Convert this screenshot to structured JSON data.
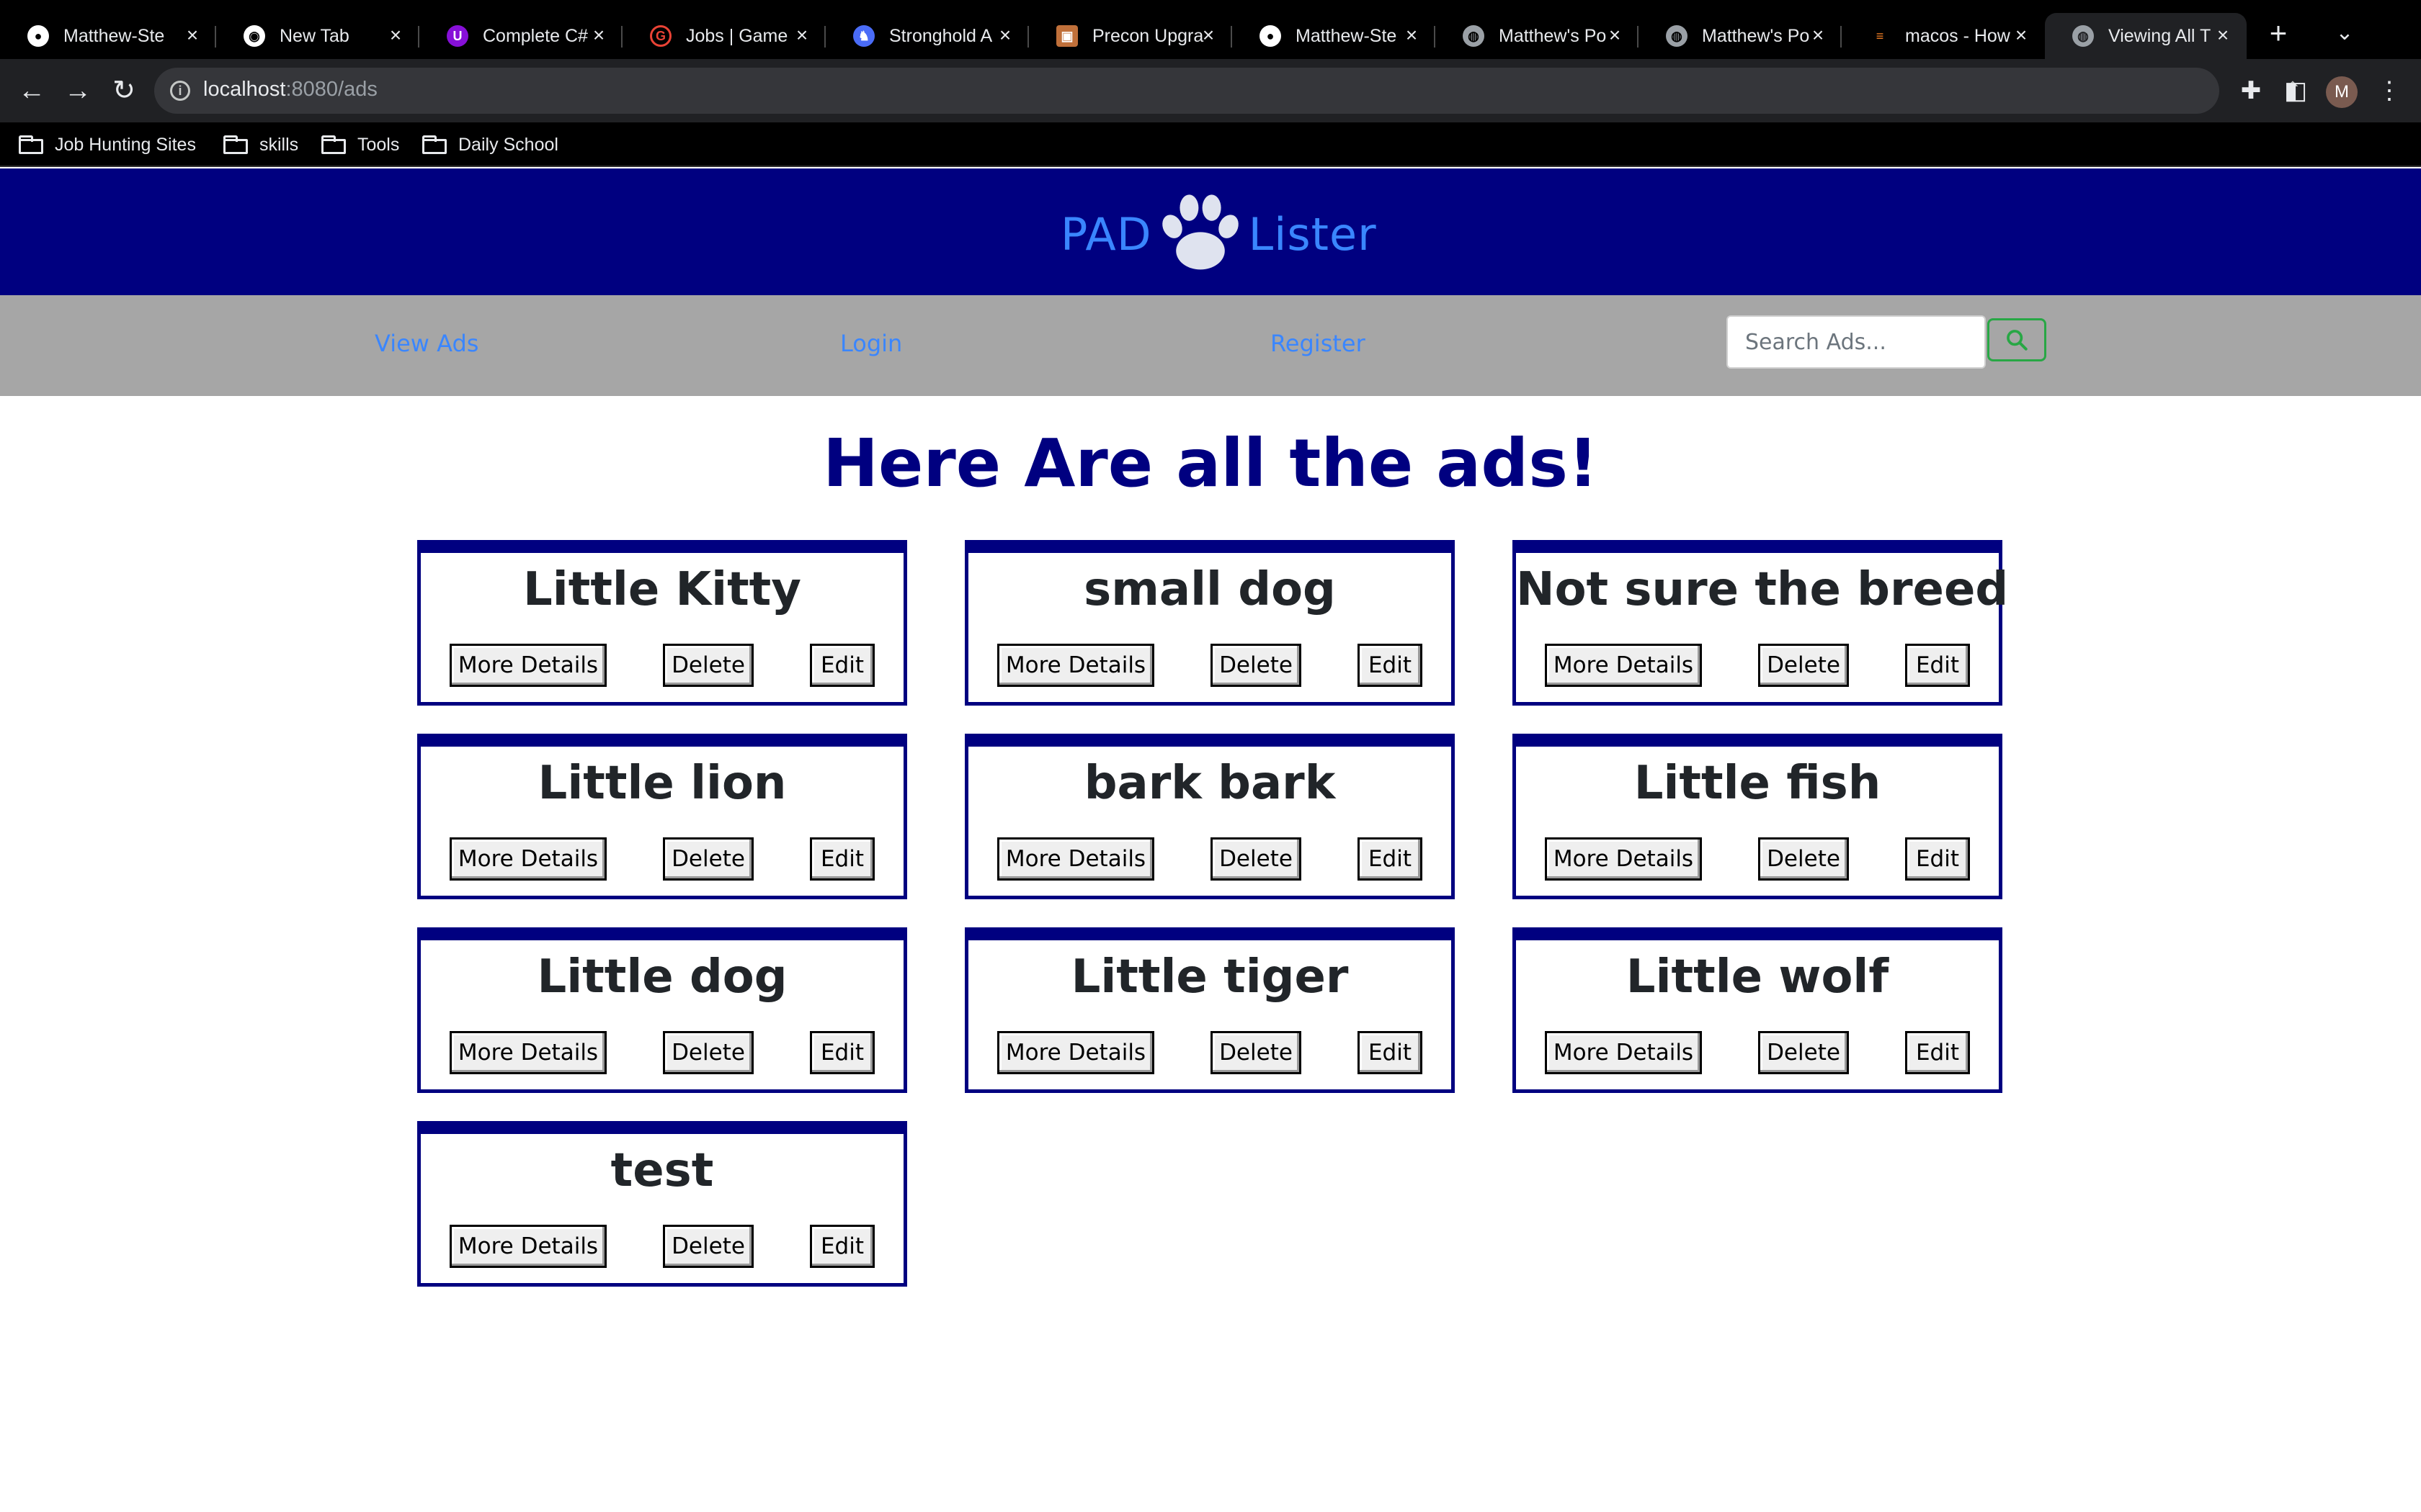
{
  "browser": {
    "tabs": [
      {
        "title": "Matthew-Ste",
        "icon": "github-icon",
        "color": "#ffffff"
      },
      {
        "title": "New Tab",
        "icon": "chrome-icon",
        "color": "#ffffff"
      },
      {
        "title": "Complete C#",
        "icon": "udemy-icon",
        "color": "#8710d8"
      },
      {
        "title": "Jobs | Game",
        "icon": "google-icon",
        "color": "#ea4335"
      },
      {
        "title": "Stronghold A",
        "icon": "game-icon",
        "color": "#4a6cf7"
      },
      {
        "title": "Precon Upgra",
        "icon": "card-icon",
        "color": "#c0703a"
      },
      {
        "title": "Matthew-Ste",
        "icon": "github-icon",
        "color": "#ffffff"
      },
      {
        "title": "Matthew's Po",
        "icon": "globe-icon",
        "color": "#9aa0a6"
      },
      {
        "title": "Matthew's Po",
        "icon": "globe-icon",
        "color": "#9aa0a6"
      },
      {
        "title": "macos - How",
        "icon": "stackoverflow-icon",
        "color": "#f48024"
      },
      {
        "title": "Viewing All T",
        "icon": "globe-icon",
        "color": "#9aa0a6",
        "active": true
      }
    ],
    "url_host": "localhost",
    "url_path": ":8080/ads",
    "avatar_initial": "M",
    "bookmarks": [
      "Job Hunting Sites",
      "skills",
      "Tools",
      "Daily School"
    ]
  },
  "site": {
    "logo_left": "PAD",
    "logo_right": "Lister",
    "nav": {
      "view_ads": "View Ads",
      "login": "Login",
      "register": "Register"
    },
    "search_placeholder": "Search Ads...",
    "page_title": "Here Are all the ads!",
    "colors": {
      "header": "#000080",
      "nav": "#a6a6a6",
      "link": "#3a86ff",
      "search_button": "#28a745"
    }
  },
  "ads": [
    {
      "title": "Little Kitty",
      "more": "More Details",
      "delete": "Delete",
      "edit": "Edit"
    },
    {
      "title": "small dog",
      "more": "More Details",
      "delete": "Delete",
      "edit": "Edit"
    },
    {
      "title": "Not sure the breed",
      "more": "More Details",
      "delete": "Delete",
      "edit": "Edit"
    },
    {
      "title": "Little lion",
      "more": "More Details",
      "delete": "Delete",
      "edit": "Edit"
    },
    {
      "title": "bark bark",
      "more": "More Details",
      "delete": "Delete",
      "edit": "Edit"
    },
    {
      "title": "Little fish",
      "more": "More Details",
      "delete": "Delete",
      "edit": "Edit"
    },
    {
      "title": "Little dog",
      "more": "More Details",
      "delete": "Delete",
      "edit": "Edit"
    },
    {
      "title": "Little tiger",
      "more": "More Details",
      "delete": "Delete",
      "edit": "Edit"
    },
    {
      "title": "Little wolf",
      "more": "More Details",
      "delete": "Delete",
      "edit": "Edit"
    },
    {
      "title": "test",
      "more": "More Details",
      "delete": "Delete",
      "edit": "Edit"
    }
  ]
}
